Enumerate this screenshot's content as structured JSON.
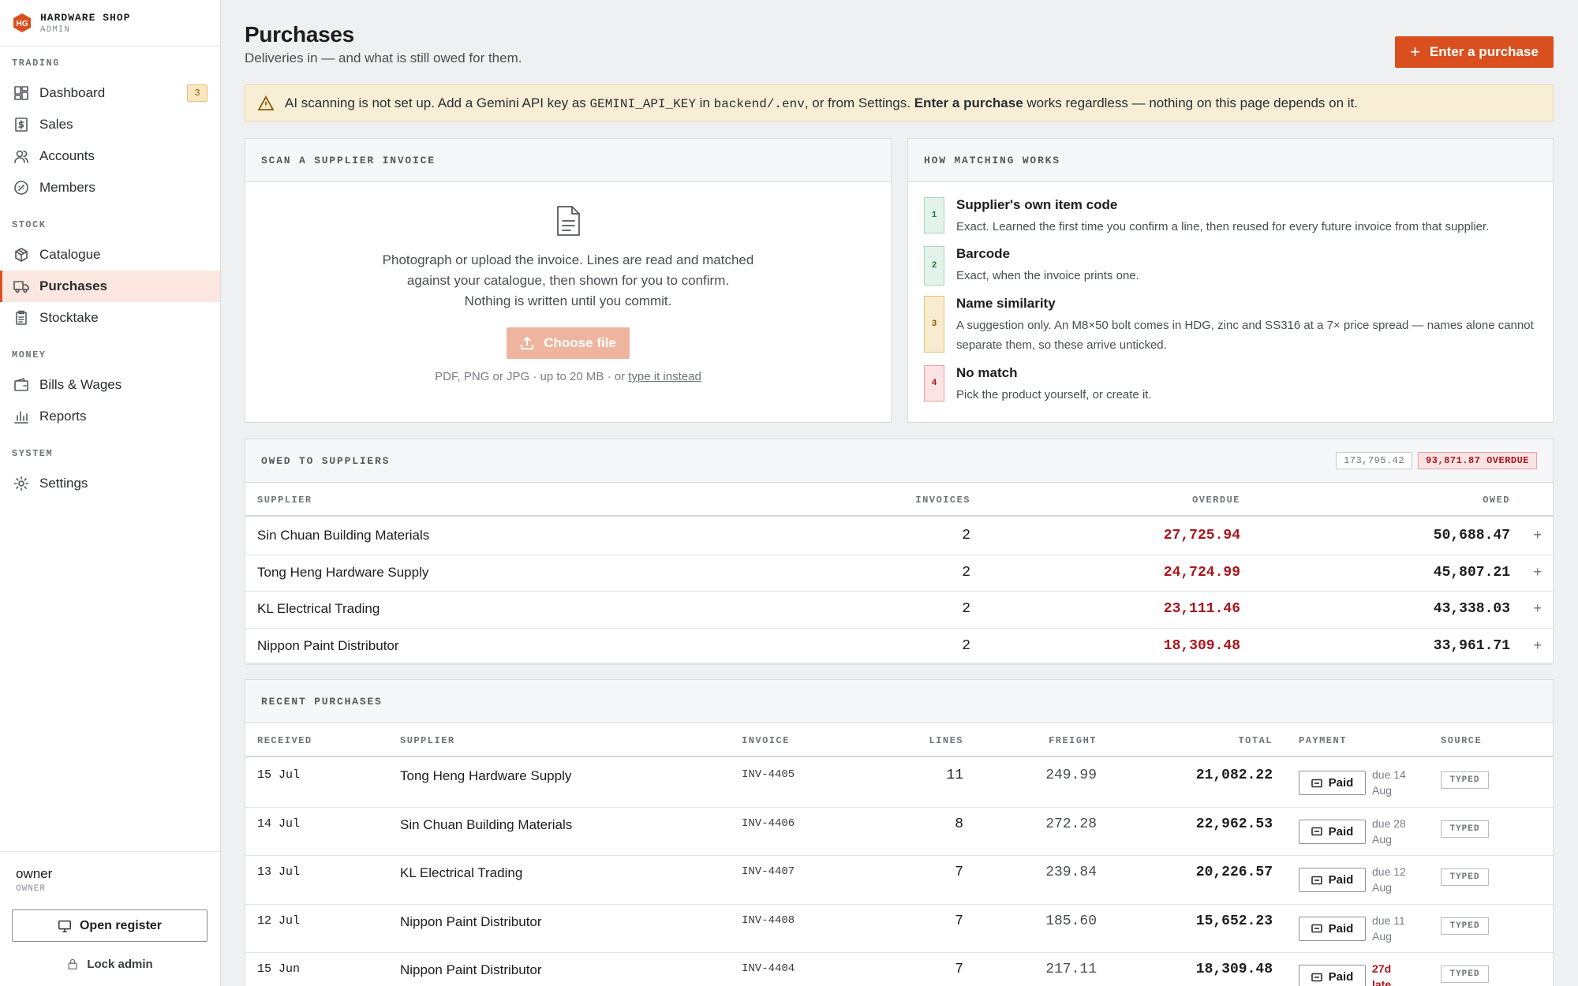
{
  "brand": {
    "logo_text": "HG",
    "name": "HARDWARE SHOP",
    "role": "ADMIN"
  },
  "nav": {
    "sections": [
      {
        "label": "TRADING",
        "items": [
          {
            "label": "Dashboard",
            "icon": "dashboard-icon",
            "badge": "3"
          },
          {
            "label": "Sales",
            "icon": "receipt-icon"
          },
          {
            "label": "Accounts",
            "icon": "users-icon"
          },
          {
            "label": "Members",
            "icon": "badge-icon"
          }
        ]
      },
      {
        "label": "STOCK",
        "items": [
          {
            "label": "Catalogue",
            "icon": "box-icon"
          },
          {
            "label": "Purchases",
            "icon": "truck-icon",
            "active": true
          },
          {
            "label": "Stocktake",
            "icon": "clipboard-icon"
          }
        ]
      },
      {
        "label": "MONEY",
        "items": [
          {
            "label": "Bills & Wages",
            "icon": "wallet-icon"
          },
          {
            "label": "Reports",
            "icon": "bar-chart-icon"
          }
        ]
      },
      {
        "label": "SYSTEM",
        "items": [
          {
            "label": "Settings",
            "icon": "gear-icon"
          }
        ]
      }
    ]
  },
  "user": {
    "name": "owner",
    "role": "OWNER",
    "open_register": "Open register",
    "lock_admin": "Lock admin"
  },
  "page": {
    "title": "Purchases",
    "subtitle": "Deliveries in — and what is still owed for them.",
    "primary_action": "Enter a purchase"
  },
  "alert": {
    "t1": "AI scanning is not set up. Add a Gemini API key as ",
    "code1": "GEMINI_API_KEY",
    "t2": " in ",
    "code2": "backend/.env",
    "t3": ", or from Settings. ",
    "bold": "Enter a purchase",
    "t4": " works regardless — nothing on this page depends on it."
  },
  "scan": {
    "heading": "SCAN A SUPPLIER INVOICE",
    "line1": "Photograph or upload the invoice. Lines are read and matched",
    "line2": "against your catalogue, then shown for you to confirm.",
    "line3": "Nothing is written until you commit.",
    "button": "Choose file",
    "hint": "PDF, PNG or JPG · up to 20 MB · or ",
    "hint_link": "type it instead"
  },
  "matching": {
    "heading": "HOW MATCHING WORKS",
    "steps": [
      {
        "num": "1",
        "title": "Supplier's own item code",
        "desc": "Exact. Learned the first time you confirm a line, then reused for every future invoice from that supplier."
      },
      {
        "num": "2",
        "title": "Barcode",
        "desc": "Exact, when the invoice prints one."
      },
      {
        "num": "3",
        "title": "Name similarity",
        "desc": "A suggestion only. An M8×50 bolt comes in HDG, zinc and SS316 at a 7× price spread — names alone cannot separate them, so these arrive unticked."
      },
      {
        "num": "4",
        "title": "No match",
        "desc": "Pick the product yourself, or create it."
      }
    ],
    "colors": [
      "#e3f3ea",
      "#e3f3ea",
      "#f8ecd0",
      "#fbe3e3"
    ]
  },
  "owed": {
    "heading": "OWED TO SUPPLIERS",
    "total": "173,795.42",
    "overdue": "93,871.87 OVERDUE",
    "columns": [
      "SUPPLIER",
      "INVOICES",
      "OVERDUE",
      "OWED"
    ],
    "rows": [
      {
        "supplier": "Sin Chuan Building Materials",
        "invoices": "2",
        "overdue": "27,725.94",
        "owed": "50,688.47"
      },
      {
        "supplier": "Tong Heng Hardware Supply",
        "invoices": "2",
        "overdue": "24,724.99",
        "owed": "45,807.21"
      },
      {
        "supplier": "KL Electrical Trading",
        "invoices": "2",
        "overdue": "23,111.46",
        "owed": "43,338.03"
      },
      {
        "supplier": "Nippon Paint Distributor",
        "invoices": "2",
        "overdue": "18,309.48",
        "owed": "33,961.71"
      }
    ]
  },
  "recent": {
    "heading": "RECENT PURCHASES",
    "columns": [
      "RECEIVED",
      "SUPPLIER",
      "INVOICE",
      "LINES",
      "FREIGHT",
      "TOTAL",
      "PAYMENT",
      "SOURCE"
    ],
    "rows": [
      {
        "received": "15 Jul",
        "supplier": "Tong Heng Hardware Supply",
        "invoice": "INV-4405",
        "lines": "11",
        "freight": "249.99",
        "total": "21,082.22",
        "payment": "Paid",
        "due1": "due 14",
        "due2": "Aug",
        "late": false,
        "source": "TYPED"
      },
      {
        "received": "14 Jul",
        "supplier": "Sin Chuan Building Materials",
        "invoice": "INV-4406",
        "lines": "8",
        "freight": "272.28",
        "total": "22,962.53",
        "payment": "Paid",
        "due1": "due 28",
        "due2": "Aug",
        "late": false,
        "source": "TYPED"
      },
      {
        "received": "13 Jul",
        "supplier": "KL Electrical Trading",
        "invoice": "INV-4407",
        "lines": "7",
        "freight": "239.84",
        "total": "20,226.57",
        "payment": "Paid",
        "due1": "due 12",
        "due2": "Aug",
        "late": false,
        "source": "TYPED"
      },
      {
        "received": "12 Jul",
        "supplier": "Nippon Paint Distributor",
        "invoice": "INV-4408",
        "lines": "7",
        "freight": "185.60",
        "total": "15,652.23",
        "payment": "Paid",
        "due1": "due 11",
        "due2": "Aug",
        "late": false,
        "source": "TYPED"
      },
      {
        "received": "15 Jun",
        "supplier": "Nippon Paint Distributor",
        "invoice": "INV-4404",
        "lines": "7",
        "freight": "217.11",
        "total": "18,309.48",
        "payment": "Paid",
        "due1": "27d",
        "due2": "late",
        "late": true,
        "source": "TYPED"
      }
    ]
  }
}
